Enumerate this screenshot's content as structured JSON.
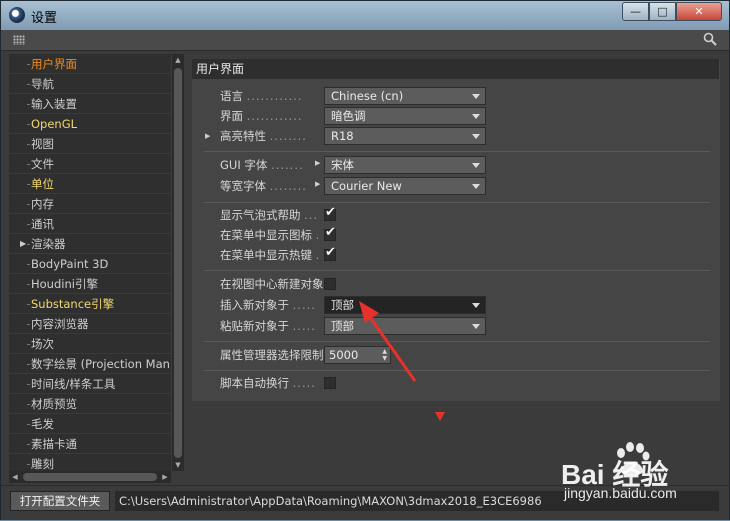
{
  "window": {
    "title": "设置",
    "min_label": "—",
    "max_label": "□",
    "close_label": "✕"
  },
  "sidebar": {
    "items": [
      {
        "label": "用户界面",
        "state": "active"
      },
      {
        "label": "导航",
        "state": "normal"
      },
      {
        "label": "输入装置",
        "state": "normal"
      },
      {
        "label": "OpenGL",
        "state": "highlight"
      },
      {
        "label": "视图",
        "state": "normal"
      },
      {
        "label": "文件",
        "state": "normal"
      },
      {
        "label": "单位",
        "state": "highlight"
      },
      {
        "label": "内存",
        "state": "normal"
      },
      {
        "label": "通讯",
        "state": "normal"
      },
      {
        "label": "渲染器",
        "state": "normal",
        "expandable": true
      },
      {
        "label": "BodyPaint 3D",
        "state": "normal"
      },
      {
        "label": "Houdini引擎",
        "state": "normal"
      },
      {
        "label": "Substance引擎",
        "state": "highlight"
      },
      {
        "label": "内容浏览器",
        "state": "normal"
      },
      {
        "label": "场次",
        "state": "normal"
      },
      {
        "label": "数字绘景 (Projection Man)",
        "state": "normal"
      },
      {
        "label": "时间线/样条工具",
        "state": "normal"
      },
      {
        "label": "材质预览",
        "state": "normal"
      },
      {
        "label": "毛发",
        "state": "normal"
      },
      {
        "label": "素描卡通",
        "state": "normal"
      },
      {
        "label": "雕刻",
        "state": "normal"
      }
    ]
  },
  "panel": {
    "header": "用户界面",
    "language": {
      "label": "语言",
      "dots": "............",
      "value": "Chinese (cn)"
    },
    "interface": {
      "label": "界面",
      "dots": "............",
      "value": "暗色调"
    },
    "highlight": {
      "label": "高亮特性",
      "dots": "........",
      "value": "R18"
    },
    "gui_font": {
      "label": "GUI 字体",
      "dots": ".......",
      "value": "宋体"
    },
    "mono_font": {
      "label": "等宽字体",
      "dots": "........",
      "value": "Courier New"
    },
    "bubble_help": {
      "label": "显示气泡式帮助",
      "dots": "...",
      "checked": true,
      "mark": "✔"
    },
    "menu_icons": {
      "label": "在菜单中显示图标",
      "dots": ".",
      "checked": true,
      "mark": "✔"
    },
    "menu_hotkeys": {
      "label": "在菜单中显示热键",
      "dots": ".",
      "checked": true,
      "mark": "✔"
    },
    "view_center": {
      "label": "在视图中心新建对象",
      "checked": false
    },
    "insert_new": {
      "label": "插入新对象于",
      "dots": ".....",
      "value": "顶部"
    },
    "paste_new": {
      "label": "粘贴新对象于",
      "dots": ".....",
      "value": "顶部"
    },
    "attr_limit": {
      "label": "属性管理器选择限制",
      "value": "5000"
    },
    "script_wrap": {
      "label": "脚本自动换行",
      "dots": ".....",
      "checked": false
    }
  },
  "bottom": {
    "open_button": "打开配置文件夹",
    "path": "C:\\Users\\Administrator\\AppData\\Roaming\\MAXON\\3dmax2018_E3CE6986"
  },
  "watermark": {
    "brand": "Bai  经验",
    "url": "jingyan.baidu.com"
  },
  "colors": {
    "active_item": "#f28a1e",
    "highlight_item": "#f1d870",
    "annotation": "#e8312a"
  }
}
